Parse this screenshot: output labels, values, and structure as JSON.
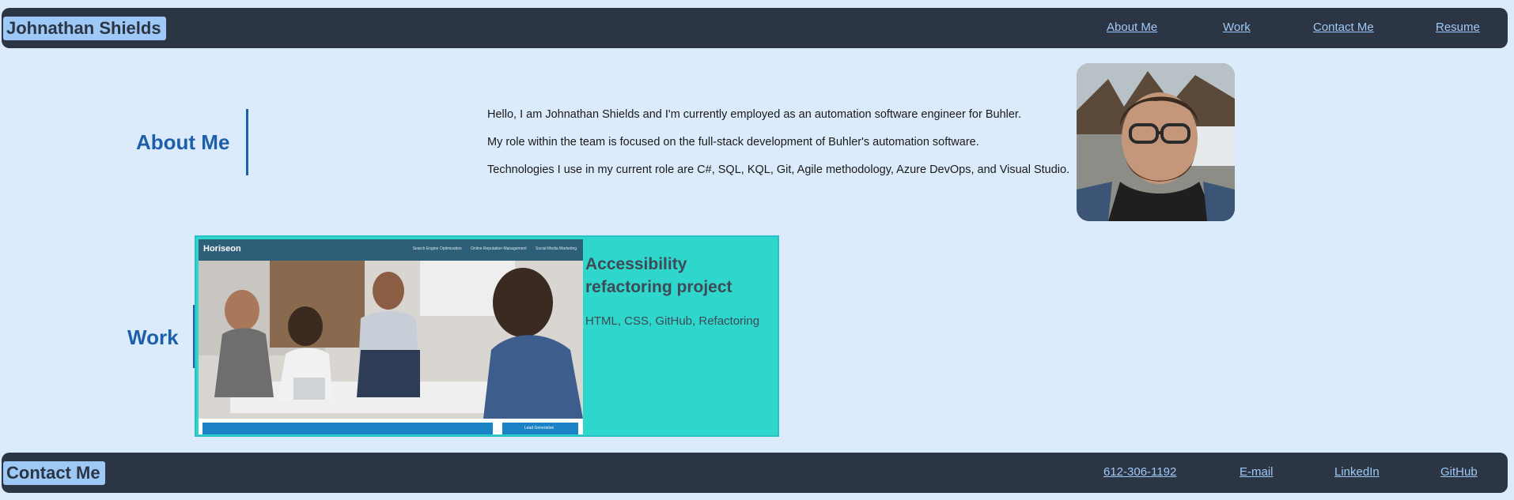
{
  "header": {
    "name": "Johnathan Shields",
    "nav": [
      "About Me",
      "Work",
      "Contact Me",
      "Resume"
    ]
  },
  "about": {
    "title": "About Me",
    "lines": [
      "Hello, I am Johnathan Shields and I'm currently employed as an automation software engineer for Buhler.",
      "My role within the team is focused on the full-stack development of Buhler's automation software.",
      "Technologies I use in my current role are C#, SQL, KQL, Git, Agile methodology, Azure DevOps, and Visual Studio."
    ]
  },
  "work": {
    "title": "Work",
    "project": {
      "title": "Accessibility refactoring project",
      "tech": "HTML, CSS, GitHub, Refactoring",
      "screenshot_logo": "Horiseon",
      "screenshot_nav": [
        "Search Engine Optimization",
        "Online Reputation Management",
        "Social Media Marketing"
      ],
      "screenshot_button": "Lead Generation"
    }
  },
  "footer": {
    "title": "Contact Me",
    "links": [
      "612-306-1192",
      "E-mail",
      "LinkedIn",
      "GitHub"
    ]
  },
  "colors": {
    "bar": "#2b3543",
    "accent": "#1d5fa8",
    "link": "#9ec9f7",
    "card": "#2fd6cc",
    "background": "#dcebfb"
  },
  "icons": [
    "profile-photo",
    "project-screenshot"
  ]
}
